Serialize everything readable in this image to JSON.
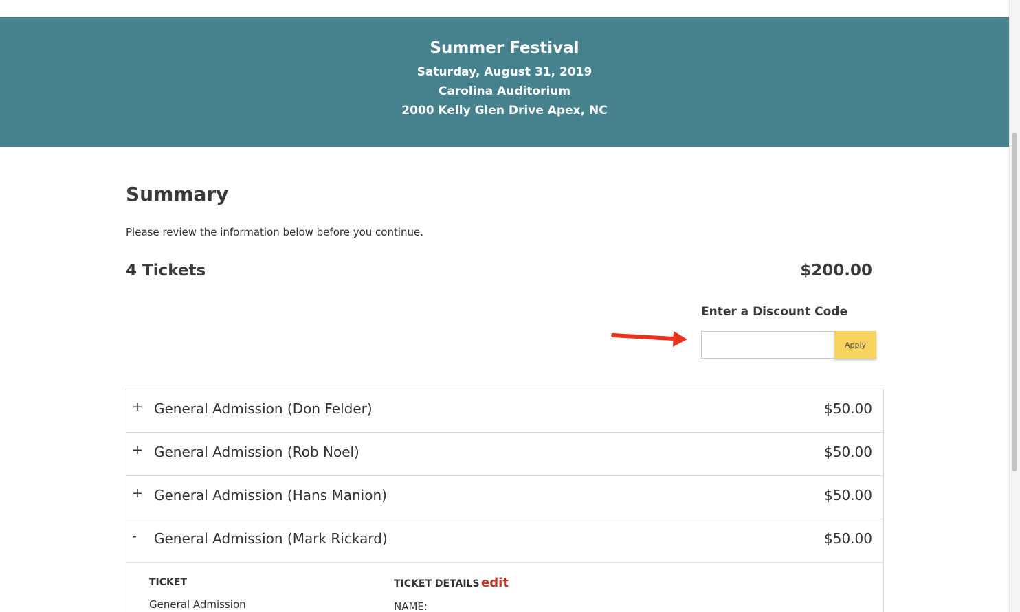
{
  "header": {
    "event_title": "Summer Festival",
    "date": "Saturday, August 31, 2019",
    "venue": "Carolina Auditorium",
    "address": "2000 Kelly Glen Drive  Apex, NC",
    "background_color": "#46818e"
  },
  "summary": {
    "title": "Summary",
    "intro": "Please review the information below before you continue.",
    "tickets_label": "4 Tickets",
    "total": "$200.00"
  },
  "discount": {
    "label": "Enter a Discount Code",
    "value": "",
    "placeholder": "",
    "apply_label": "Apply",
    "apply_color": "#f7d35f"
  },
  "tickets": [
    {
      "toggle": "+",
      "name": "General Admission (Don Felder)",
      "price": "$50.00"
    },
    {
      "toggle": "+",
      "name": "General Admission (Rob Noel)",
      "price": "$50.00"
    },
    {
      "toggle": "+",
      "name": "General Admission (Hans Manion)",
      "price": "$50.00"
    },
    {
      "toggle": "-",
      "name": "General Admission (Mark Rickard)",
      "price": "$50.00"
    }
  ],
  "expanded_details": {
    "ticket_header": "TICKET",
    "ticket_value": "General Admission",
    "details_header": "TICKET DETAILS",
    "edit_label": "edit",
    "name_label": "NAME:",
    "edit_color": "#c0392b"
  },
  "annotation": {
    "arrow_color": "#e8321e"
  }
}
